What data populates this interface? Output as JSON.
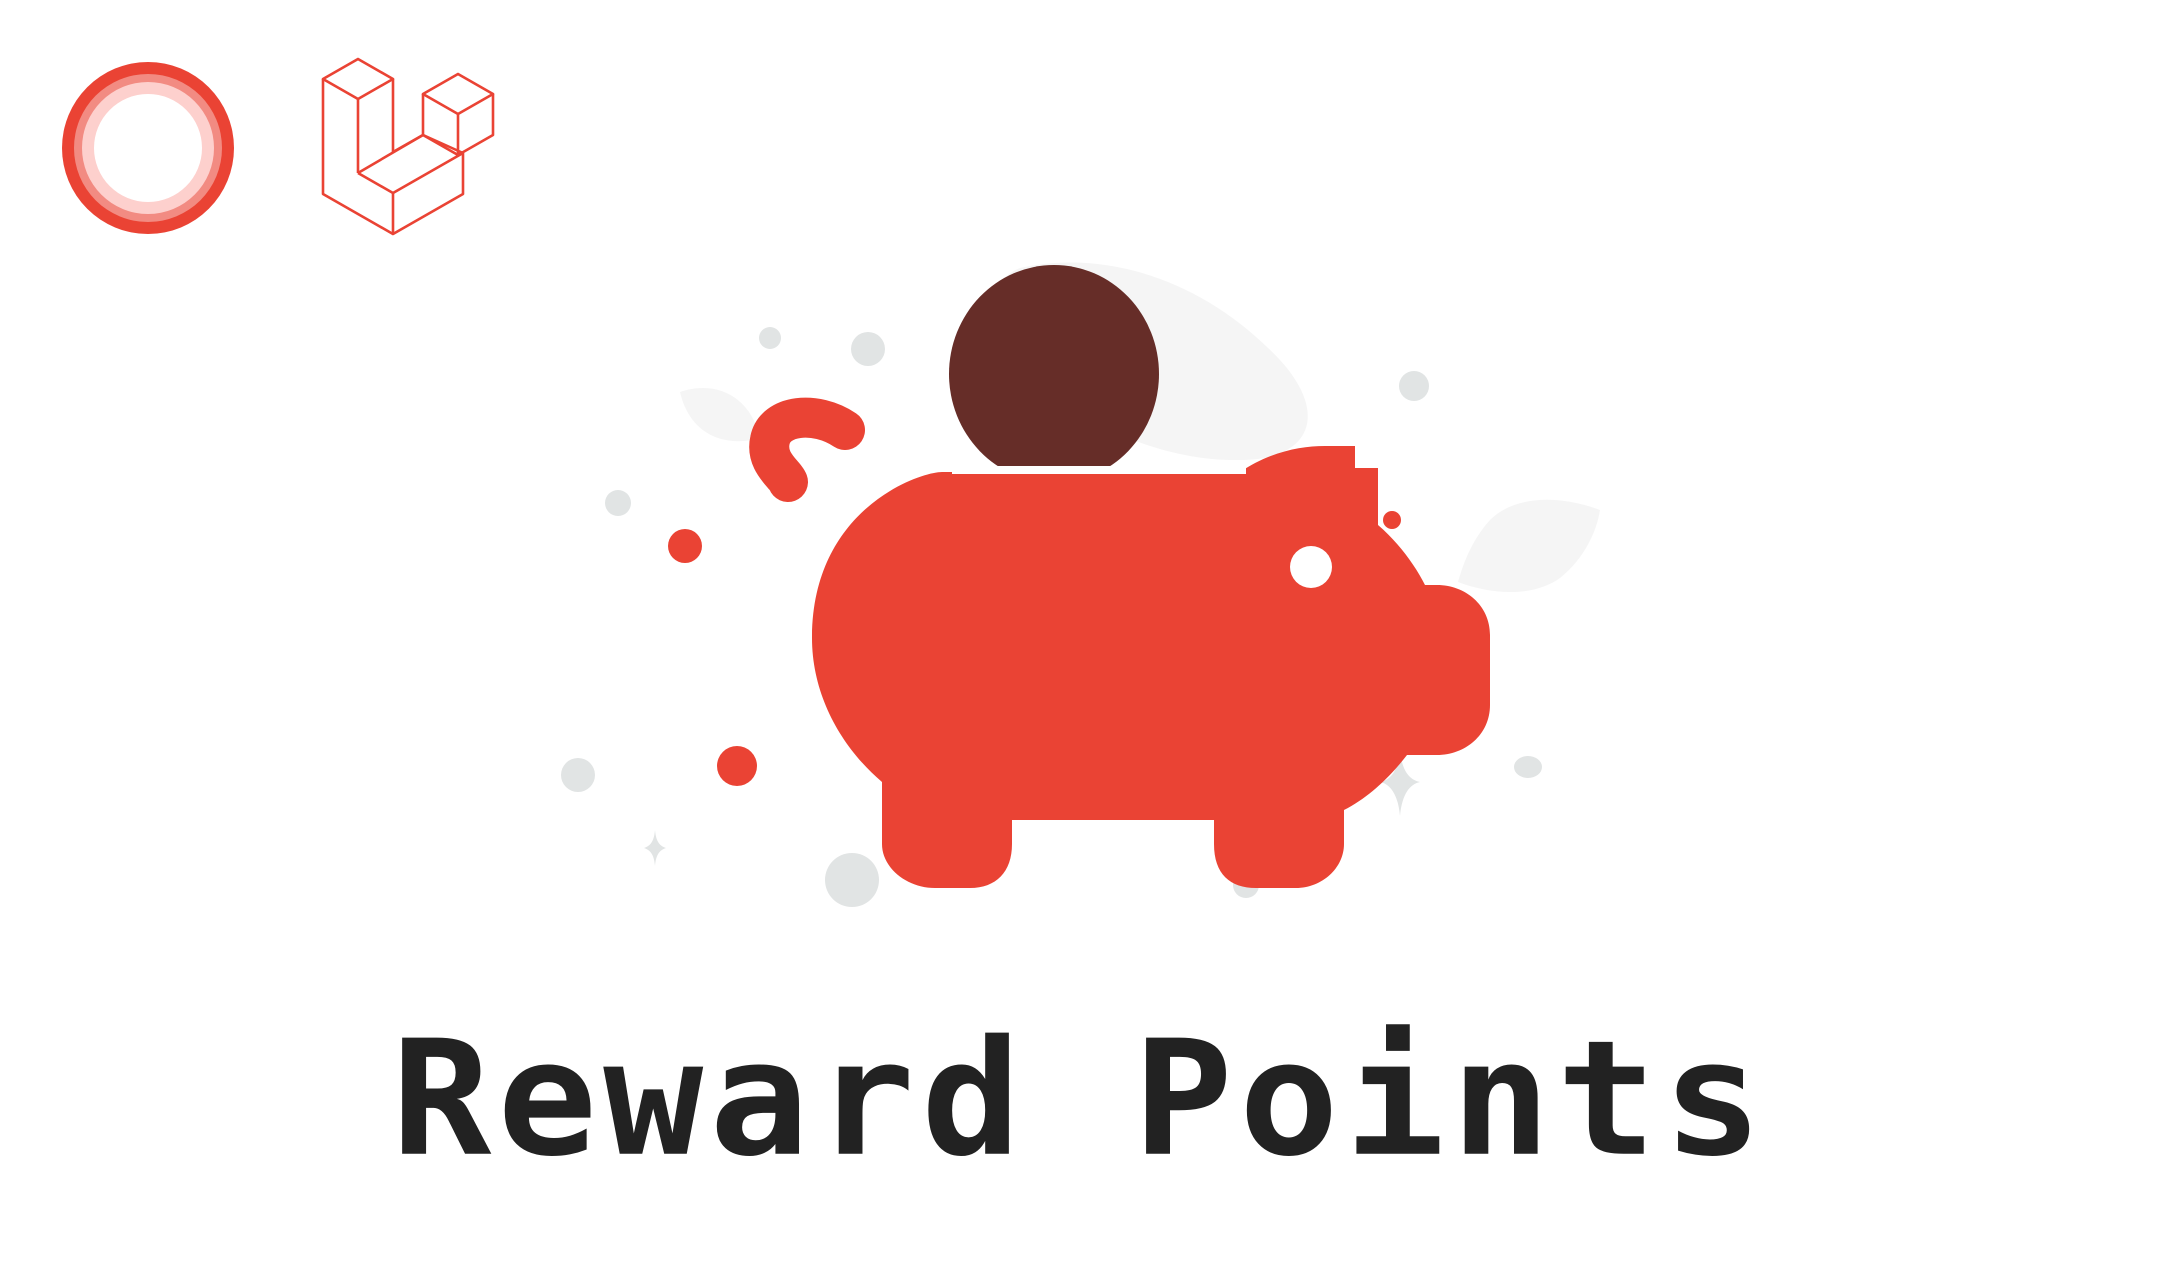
{
  "title": "Reward Points",
  "colors": {
    "brand_red": "#ea4334",
    "coin_brown": "#662d28",
    "dot_grey": "#e1e4e4",
    "leaf_grey": "#f5f5f5",
    "title_text": "#222222"
  },
  "icons": {
    "brand_ring_logo": "ring-logo-icon",
    "laravel_logo": "laravel-logo-icon",
    "piggy_bank": "piggy-bank-icon",
    "coin": "coin-icon"
  }
}
